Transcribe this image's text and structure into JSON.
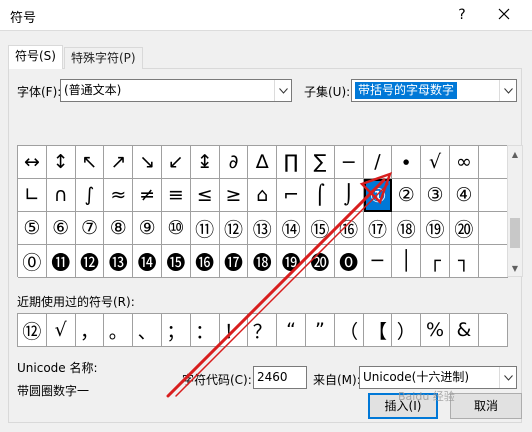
{
  "window": {
    "title": "符号",
    "help_label": "?"
  },
  "tabs": [
    {
      "label": "符号(S)"
    },
    {
      "label": "特殊字符(P)"
    }
  ],
  "font": {
    "label": "字体(F):",
    "value": "(普通文本)"
  },
  "subset": {
    "label": "子集(U):",
    "value": "带括号的字母数字"
  },
  "symbol_grid": {
    "rows": [
      [
        "↔",
        "↕",
        "↖",
        "↗",
        "↘",
        "↙",
        "↨",
        "∂",
        "∆",
        "∏",
        "∑",
        "−",
        "∕",
        "∙",
        "√",
        "∞",
        ""
      ],
      [
        "∟",
        "∩",
        "∫",
        "≈",
        "≠",
        "≡",
        "≤",
        "≥",
        "⌂",
        "⌐",
        "⌠",
        "⌡",
        "①",
        "②",
        "③",
        "④",
        ""
      ],
      [
        "⑤",
        "⑥",
        "⑦",
        "⑧",
        "⑨",
        "⑩",
        "⑪",
        "⑫",
        "⑬",
        "⑭",
        "⑮",
        "⑯",
        "⑰",
        "⑱",
        "⑲",
        "⑳",
        ""
      ],
      [
        "⓪",
        "⓫",
        "⓬",
        "⓭",
        "⓮",
        "⓯",
        "⓰",
        "⓱",
        "⓲",
        "⓳",
        "⓴",
        "⓿",
        "─",
        "│",
        "┌",
        "┐",
        ""
      ]
    ],
    "selected_symbol": "①"
  },
  "recent": {
    "label": "近期使用过的符号(R):",
    "symbols": [
      "⑫",
      "√",
      "，",
      "。",
      "、",
      "；",
      "：",
      "！",
      "？",
      "“",
      "”",
      "（",
      "【",
      "）",
      "%",
      "&",
      ""
    ]
  },
  "unicode_name": {
    "label": "Unicode 名称:",
    "value": "带圆圈数字一"
  },
  "char_code": {
    "label": "字符代码(C):",
    "value": "2460"
  },
  "from": {
    "label": "来自(M):",
    "value": "Unicode(十六进制)"
  },
  "buttons": {
    "insert": "插入(I)",
    "cancel": "取消"
  },
  "watermark": "Baidu 经验"
}
